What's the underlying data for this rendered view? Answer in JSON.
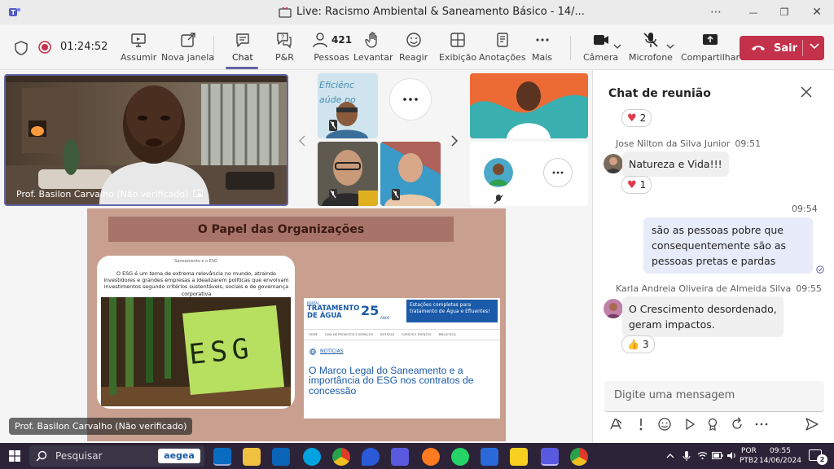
{
  "window": {
    "title": "Live: Racismo Ambiental & Saneamento Básico - 14/...",
    "more_glyph": "⋯",
    "minimize_glyph": "—",
    "restore_glyph": "❐",
    "close_glyph": "✕"
  },
  "toolbar": {
    "timer": "01:24:52",
    "items": [
      {
        "label": "Assumir",
        "icon": "present-icon"
      },
      {
        "label": "Nova janela",
        "icon": "pop-out-icon"
      },
      {
        "label": "Chat",
        "icon": "chat-icon",
        "active": true
      },
      {
        "label": "P&R",
        "icon": "qa-icon"
      },
      {
        "label": "Pessoas",
        "icon": "people-icon",
        "count": "421"
      },
      {
        "label": "Levantar",
        "icon": "raise-hand-icon"
      },
      {
        "label": "Reagir",
        "icon": "react-icon"
      },
      {
        "label": "Exibição",
        "icon": "view-icon"
      },
      {
        "label": "Anotações",
        "icon": "notes-icon"
      },
      {
        "label": "Mais",
        "icon": "more-icon"
      },
      {
        "label": "Câmera",
        "icon": "camera-icon"
      },
      {
        "label": "Microfone",
        "icon": "mic-off-icon"
      },
      {
        "label": "Compartilhar",
        "icon": "share-icon"
      }
    ],
    "leave_label": "Sair"
  },
  "stage": {
    "main_speaker_name": "Prof. Basilon Carvalho (Não verificado)",
    "shared_screen_label": "Prof. Basilon Carvalho (Não verificado)",
    "thumb_text": "Eficiênc aúde po",
    "slide": {
      "title": "O Papel das Organizações",
      "left_card_header": "Saneamento e o ESG",
      "left_card_text": "O ESG é um tema de extrema relevância no mundo, atraindo investidores e grandes empresas a idealizarem políticas que envolvam investimentos segundo critérios sustentáveis, sociais e de governança corporativa",
      "esg_note": "ESG",
      "right_brand_top": "PORTAL",
      "right_brand_main": "TRATAMENTO DE ÁGUA",
      "right_brand_years": "25",
      "right_brand_anos": "ANOS",
      "right_banner": "Estações completas para tratamento de Água e Efluentes!",
      "right_nav": [
        "HOME",
        "GUIA DE PRODUTOS E SERVIÇOS",
        "NOTÍCIAS",
        "CURSOS E EVENTOS",
        "BIBLIOTECA"
      ],
      "right_section": "NOTÍCIAS",
      "right_headline": "O Marco Legal do Saneamento e a importância do ESG nos contratos de concessão"
    }
  },
  "chat": {
    "title": "Chat de reunião",
    "messages": [
      {
        "reaction": "2"
      },
      {
        "sender": "Jose Nilton da Silva Junior",
        "time": "09:51",
        "text": "Natureza e Vida!!!",
        "reaction": "1"
      },
      {
        "time": "09:54",
        "text": "são as pessoas pobre que consequentemente são as pessoas pretas e pardas",
        "mine": true
      },
      {
        "sender": "Karla Andreia Oliveira de Almeida Silva",
        "time": "09:55",
        "text": "O Crescimento desordenado, geram impactos.",
        "reaction": "3"
      }
    ],
    "compose_placeholder": "Digite uma mensagem"
  },
  "taskbar": {
    "search_placeholder": "Pesquisar",
    "search_badge": "aegea",
    "lang_top": "POR",
    "lang_bottom": "PTB2",
    "time": "09:55",
    "date": "14/06/2024",
    "notifications": "2"
  },
  "colors": {
    "accent": "#6264a7",
    "leave": "#c4314b",
    "slide_bg": "#c9a08f",
    "slide_title_bg": "#a8746a"
  }
}
